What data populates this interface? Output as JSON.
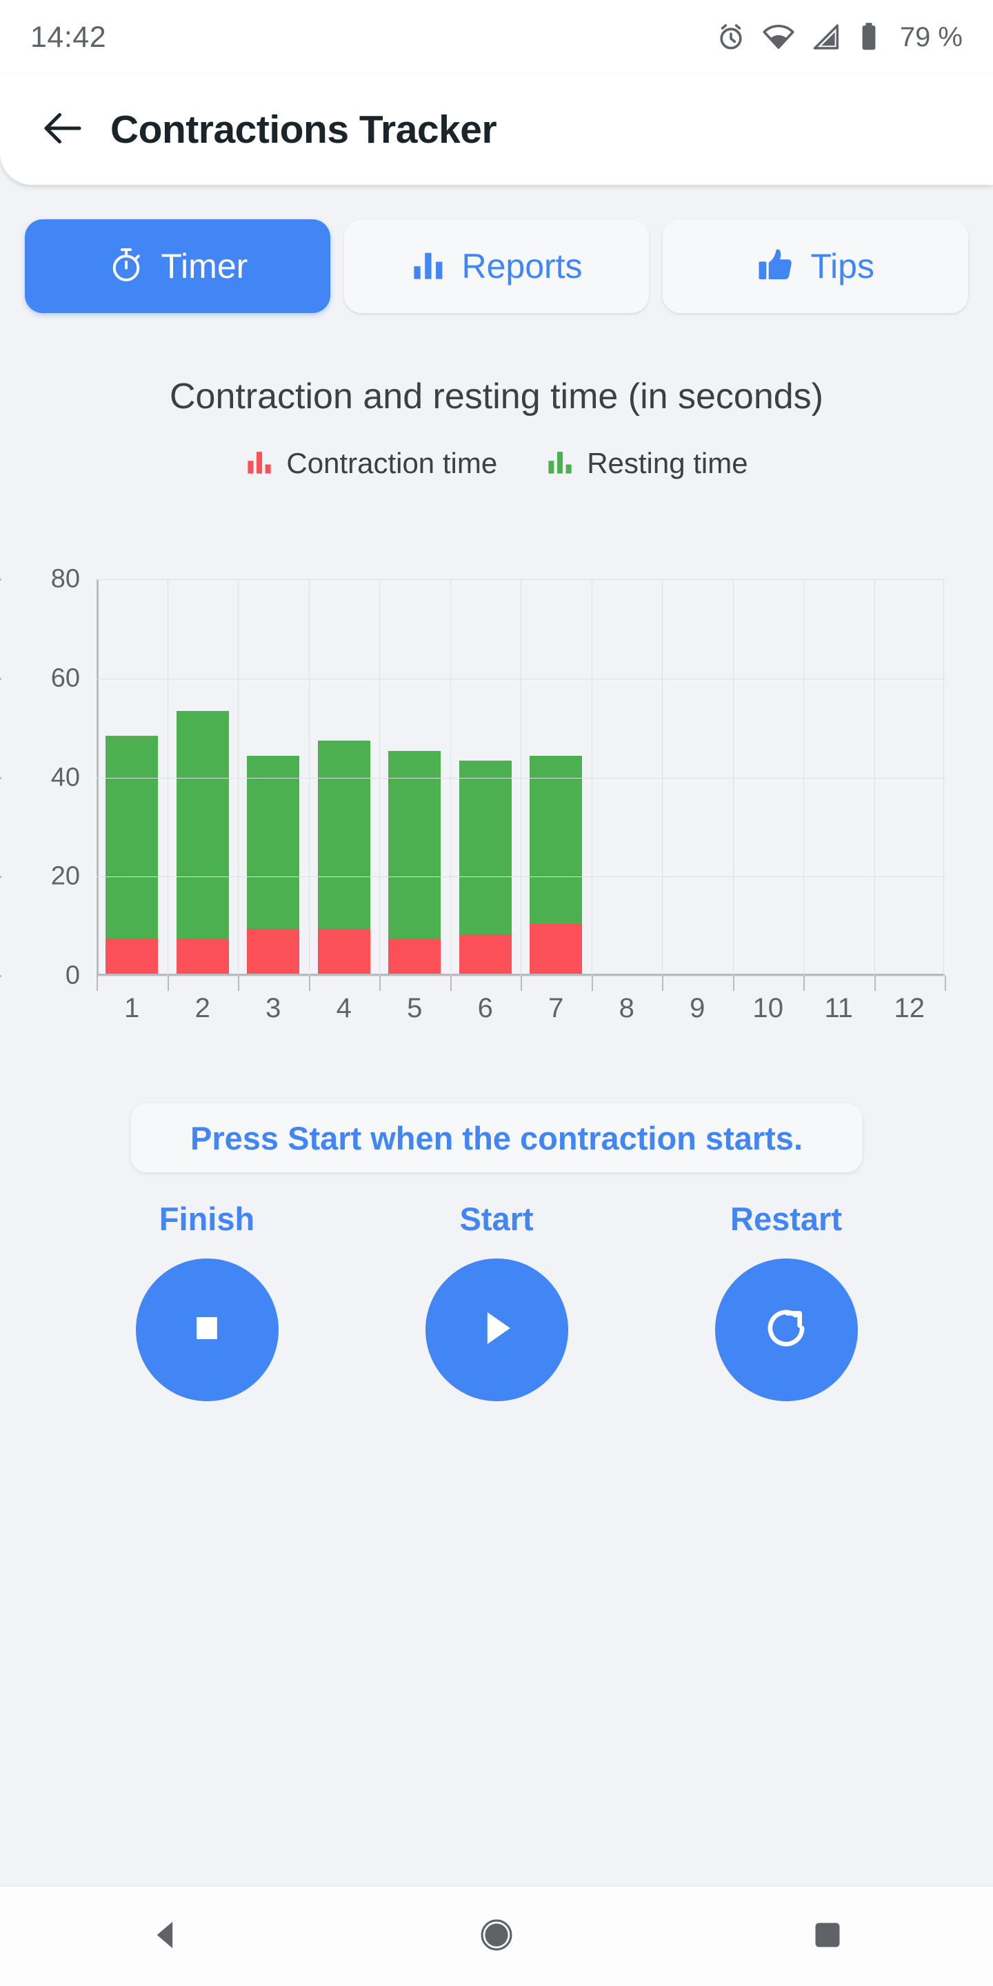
{
  "status_bar": {
    "time": "14:42",
    "battery_text": "79 %",
    "icons": [
      "alarm-icon",
      "wifi-icon",
      "signal-icon",
      "battery-icon"
    ]
  },
  "app_bar": {
    "back_icon": "back-arrow-icon",
    "title": "Contractions Tracker"
  },
  "tabs": [
    {
      "label": "Timer",
      "icon": "stopwatch-icon",
      "active": true
    },
    {
      "label": "Reports",
      "icon": "bar-chart-icon",
      "active": false
    },
    {
      "label": "Tips",
      "icon": "thumbs-up-icon",
      "active": false
    }
  ],
  "colors": {
    "accent_blue": "#4285f4",
    "contraction_red": "#fb5058",
    "resting_green": "#4caf50",
    "page_bg": "#f1f3f6",
    "card_bg": "#f7f8fa"
  },
  "hint": {
    "text": "Press Start when the contraction starts."
  },
  "controls": [
    {
      "label": "Finish",
      "icon": "stop-icon"
    },
    {
      "label": "Start",
      "icon": "play-icon"
    },
    {
      "label": "Restart",
      "icon": "refresh-icon"
    }
  ],
  "nav_bar": {
    "back": "nav-back-icon",
    "home": "nav-home-icon",
    "recents": "nav-recents-icon"
  },
  "chart_data": {
    "type": "bar",
    "title": "Contraction and resting time (in seconds)",
    "stacked": true,
    "xlabel": "",
    "ylabel": "",
    "ylim": [
      0,
      80
    ],
    "yticks": [
      0,
      20,
      40,
      60,
      80
    ],
    "grid": true,
    "legend_position": "top",
    "categories": [
      "1",
      "2",
      "3",
      "4",
      "5",
      "6",
      "7",
      "8",
      "9",
      "10",
      "11",
      "12"
    ],
    "series": [
      {
        "name": "Contraction time",
        "color": "#fb5058",
        "values": [
          7,
          7,
          9,
          9,
          7,
          8,
          10,
          null,
          null,
          null,
          null,
          null
        ]
      },
      {
        "name": "Resting time",
        "color": "#4caf50",
        "values": [
          41,
          46,
          35,
          38,
          38,
          35,
          34,
          null,
          null,
          null,
          null,
          null
        ]
      }
    ],
    "totals": [
      48,
      53,
      44,
      47,
      45,
      43,
      44,
      null,
      null,
      null,
      null,
      null
    ]
  }
}
